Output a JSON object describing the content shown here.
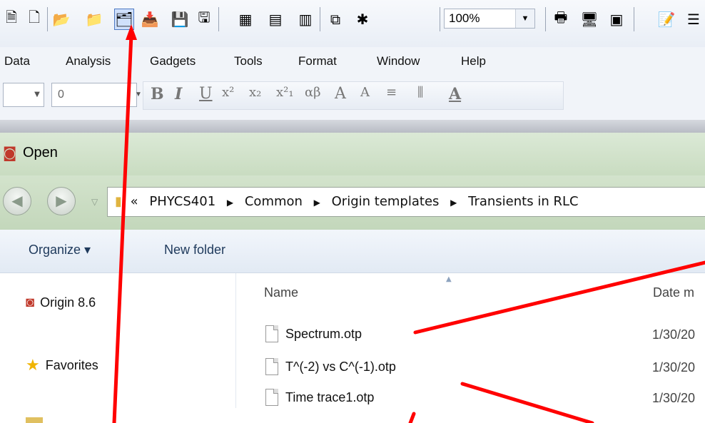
{
  "toolbar": {
    "zoom_value": "100%"
  },
  "menus": [
    "Data",
    "Analysis",
    "Gadgets",
    "Tools",
    "Format",
    "Window",
    "Help"
  ],
  "format_bar": {
    "font_size_value": "0"
  },
  "dialog": {
    "title": "Open",
    "breadcrumb_prefix": "«",
    "breadcrumbs": [
      "PHYCS401",
      "Common",
      "Origin templates",
      "Transients in RLC"
    ],
    "organize_label": "Organize ▾",
    "new_folder_label": "New folder",
    "nav_items": [
      "Origin 8.6",
      "Favorites"
    ],
    "columns": {
      "name": "Name",
      "date": "Date m"
    },
    "files": [
      {
        "name": "Spectrum.otp",
        "date": "1/30/20"
      },
      {
        "name": "T^(-2) vs C^(-1).otp",
        "date": "1/30/20"
      },
      {
        "name": "Time trace1.otp",
        "date": "1/30/20"
      }
    ]
  },
  "colors": {
    "annotation_arrow": "#ff0000",
    "dialog_title_bg": "#c9dcc1",
    "selected_button": "#4d79c3"
  }
}
